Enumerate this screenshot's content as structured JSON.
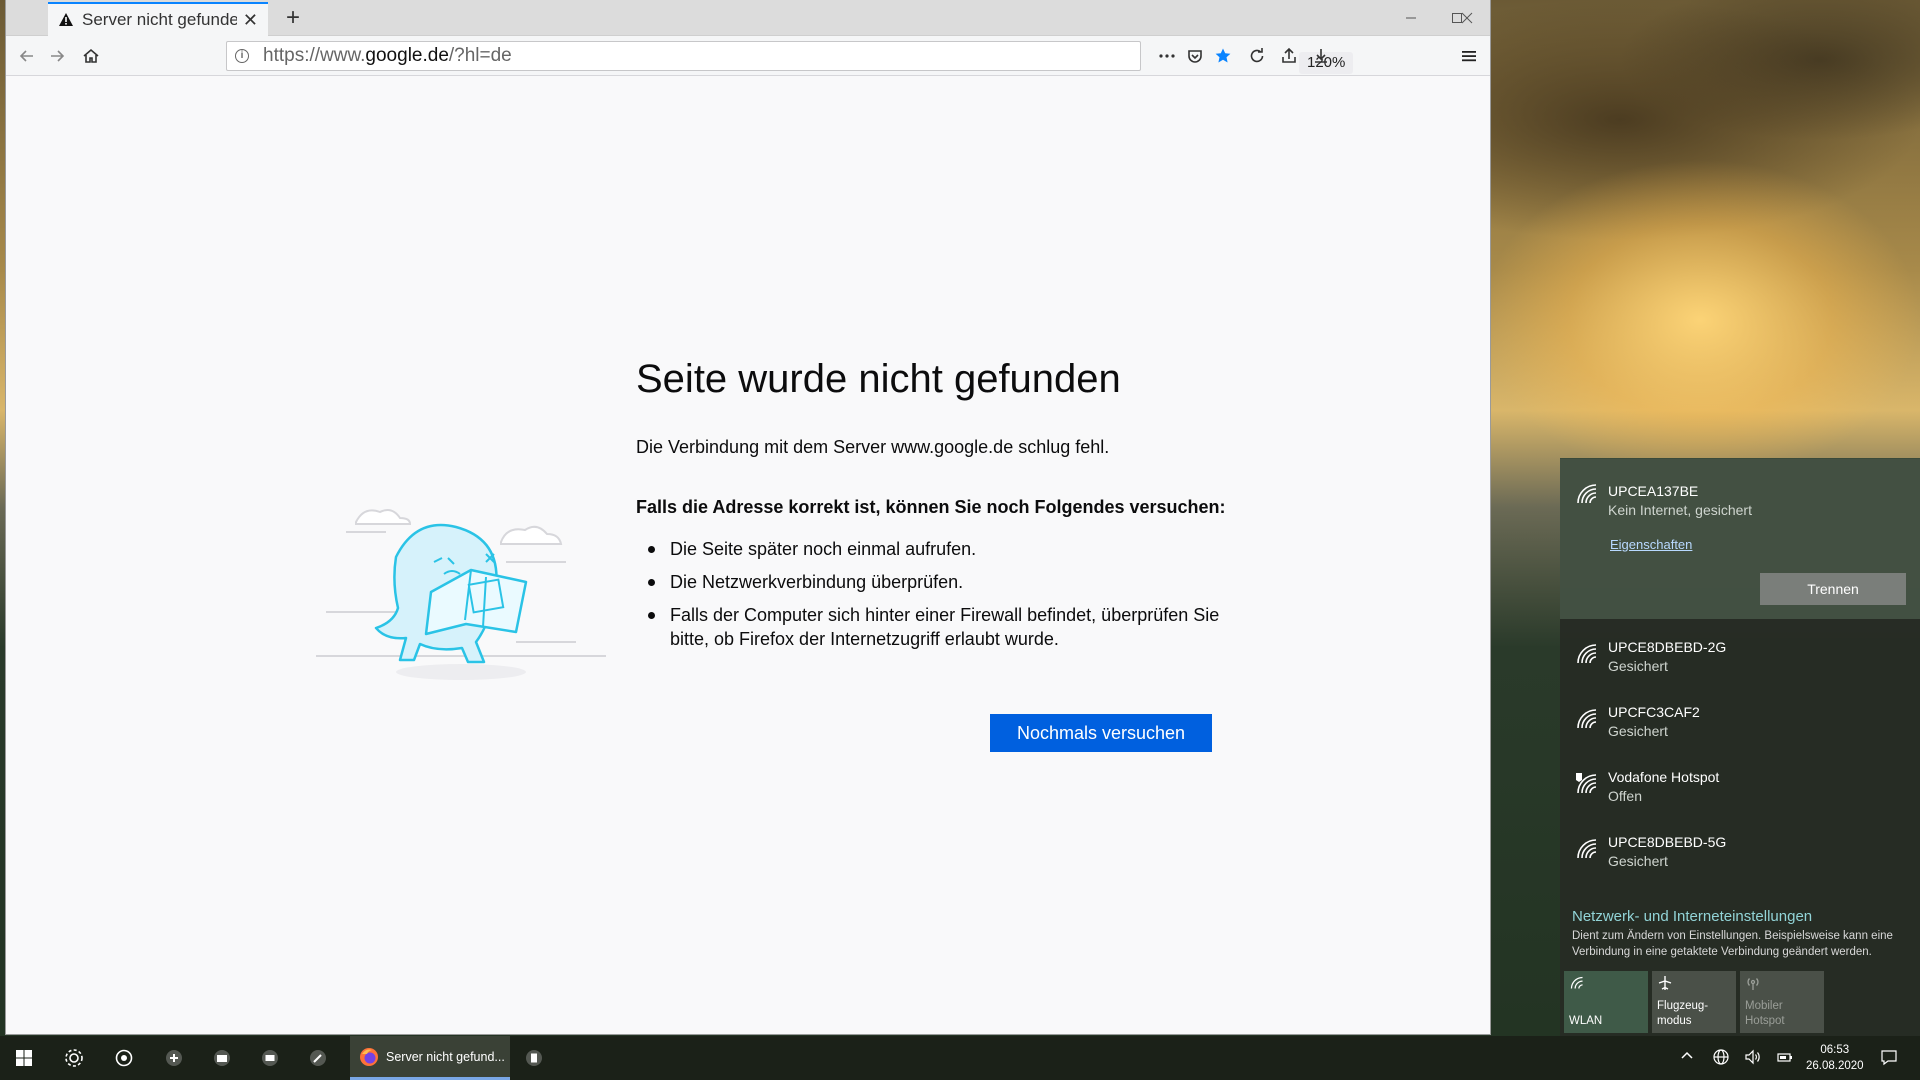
{
  "browser": {
    "tab_title": "Server nicht gefunden",
    "url_prefix": "https://www.",
    "url_host": "google.de",
    "url_path": "/?hl=de",
    "zoom": "120%"
  },
  "error": {
    "title": "Seite wurde nicht gefunden",
    "description": "Die Verbindung mit dem Server www.google.de schlug fehl.",
    "subtitle": "Falls die Adresse korrekt ist, können Sie noch Folgendes versuchen:",
    "suggestions": [
      "Die Seite später noch einmal aufrufen.",
      "Die Netzwerkverbindung überprüfen.",
      "Falls der Computer sich hinter einer Firewall befindet, überprüfen Sie bitte, ob Firefox der Internetzugriff erlaubt wurde."
    ],
    "retry_label": "Nochmals versuchen"
  },
  "network": {
    "active": {
      "name": "UPCEA137BE",
      "status": "Kein Internet, gesichert",
      "properties_link": "Eigenschaften",
      "disconnect_label": "Trennen"
    },
    "networks": [
      {
        "name": "UPCE8DBEBD-2G",
        "status": "Gesichert"
      },
      {
        "name": "UPCFC3CAF2",
        "status": "Gesichert"
      },
      {
        "name": "Vodafone Hotspot",
        "status": "Offen"
      },
      {
        "name": "UPCE8DBEBD-5G",
        "status": "Gesichert"
      }
    ],
    "settings_title": "Netzwerk- und Interneteinstellungen",
    "settings_desc": "Dient zum Ändern von Einstellungen. Beispielsweise kann eine Verbindung in eine getaktete Verbindung geändert werden.",
    "tiles": [
      {
        "label": "WLAN",
        "active": true
      },
      {
        "label": "Flugzeug-\nmodus",
        "active": false
      },
      {
        "label": "Mobiler\nHotspot",
        "active": false,
        "disabled": true
      }
    ]
  },
  "taskbar": {
    "app_label": "Server nicht gefund...",
    "time": "06:53",
    "date": "26.08.2020"
  },
  "colors": {
    "accent": "#0a84ff",
    "button_blue": "#0060df",
    "flyout_link": "#92d4d7"
  }
}
